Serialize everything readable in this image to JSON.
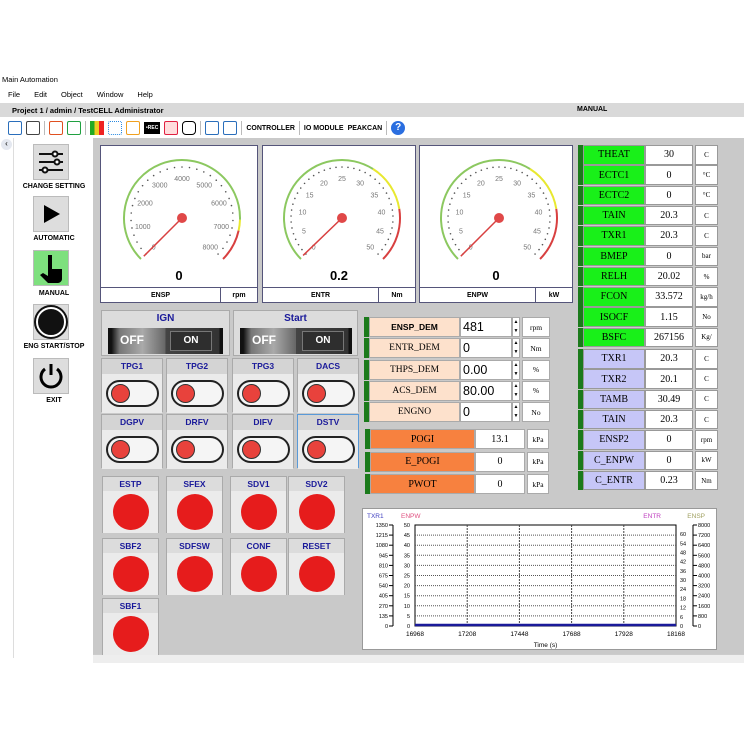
{
  "window": {
    "title": "Main Automation",
    "menu": [
      "File",
      "Edit",
      "Object",
      "Window",
      "Help"
    ],
    "project": "Project 1 / admin / TestCELL Administrator",
    "mode": "MANUAL"
  },
  "toolbar": {
    "controller": "CONTROLLER",
    "io_module": "IO MODULE",
    "peakcan": "PEAKCAN",
    "rec": "•REC",
    "help": "?"
  },
  "sidebar": {
    "collapse": "‹",
    "items": [
      {
        "label": "CHANGE SETTING",
        "icon": "sliders-icon"
      },
      {
        "label": "AUTOMATIC",
        "icon": "play-icon"
      },
      {
        "label": "MANUAL",
        "icon": "hand-pointer-icon",
        "active": true
      },
      {
        "label": "ENG START/STOP",
        "icon": "engine-start-stop-icon",
        "badge": "ENGINE START STOP"
      },
      {
        "label": "EXIT",
        "icon": "power-icon"
      }
    ]
  },
  "gauges": [
    {
      "name": "ENSP",
      "unit": "rpm",
      "value": "0",
      "min": 0,
      "max": 8000,
      "ticks": [
        "0",
        "1000",
        "2000",
        "3000",
        "4000",
        "5000",
        "6000",
        "7000",
        "8000"
      ],
      "needle": 0
    },
    {
      "name": "ENTR",
      "unit": "Nm",
      "value": "0.2",
      "min": 0,
      "max": 50,
      "ticks": [
        "0",
        "5",
        "10",
        "15",
        "20",
        "25",
        "30",
        "35",
        "40",
        "45",
        "50"
      ],
      "needle": 0.2
    },
    {
      "name": "ENPW",
      "unit": "kW",
      "value": "0",
      "min": 0,
      "max": 50,
      "ticks": [
        "0",
        "5",
        "10",
        "15",
        "20",
        "25",
        "30",
        "35",
        "40",
        "45",
        "50"
      ],
      "needle": 0
    }
  ],
  "rockers": [
    {
      "label": "IGN",
      "off": "OFF",
      "on": "ON"
    },
    {
      "label": "Start",
      "off": "OFF",
      "on": "ON"
    }
  ],
  "toggles": [
    "TPG1",
    "TPG2",
    "TPG3",
    "DACS",
    "DGPV",
    "DRFV",
    "DIFV",
    "DSTV"
  ],
  "buttons": [
    "ESTP",
    "SFEX",
    "SDV1",
    "SDV2",
    "SBF2",
    "SDFSW",
    "CONF",
    "RESET",
    "SBF1"
  ],
  "demands": [
    {
      "label": "ENSP_DEM",
      "value": "481",
      "unit": "rpm"
    },
    {
      "label": "ENTR_DEM",
      "value": "0",
      "unit": "Nm"
    },
    {
      "label": "THPS_DEM",
      "value": "0.00",
      "unit": "%"
    },
    {
      "label": "ACS_DEM",
      "value": "80.00",
      "unit": "%"
    },
    {
      "label": "ENGNO",
      "value": "0",
      "unit": "No"
    }
  ],
  "pressures": [
    {
      "label": "POGI",
      "value": "13.1",
      "unit": "kPa"
    },
    {
      "label": "E_POGI",
      "value": "0",
      "unit": "kPa"
    },
    {
      "label": "PWOT",
      "value": "0",
      "unit": "kPa"
    }
  ],
  "readings": [
    {
      "label": "THEAT",
      "value": "30",
      "unit": "C",
      "group": "green"
    },
    {
      "label": "ECTC1",
      "value": "0",
      "unit": "°C",
      "group": "green"
    },
    {
      "label": "ECTC2",
      "value": "0",
      "unit": "°C",
      "group": "green"
    },
    {
      "label": "TAIN",
      "value": "20.3",
      "unit": "C",
      "group": "green"
    },
    {
      "label": "TXR1",
      "value": "20.3",
      "unit": "C",
      "group": "green"
    },
    {
      "label": "BMEP",
      "value": "0",
      "unit": "bar",
      "group": "green"
    },
    {
      "label": "RELH",
      "value": "20.02",
      "unit": "%",
      "group": "green"
    },
    {
      "label": "FCON",
      "value": "33.572",
      "unit": "kg/h",
      "group": "green"
    },
    {
      "label": "ISOCF",
      "value": "1.15",
      "unit": "No",
      "group": "green"
    },
    {
      "label": "BSFC",
      "value": "267156",
      "unit": "Kg/",
      "group": "green"
    },
    {
      "label": "TXR1",
      "value": "20.3",
      "unit": "C",
      "group": "blue"
    },
    {
      "label": "TXR2",
      "value": "20.1",
      "unit": "C",
      "group": "blue"
    },
    {
      "label": "TAMB",
      "value": "30.49",
      "unit": "C",
      "group": "blue"
    },
    {
      "label": "TAIN",
      "value": "20.3",
      "unit": "C",
      "group": "blue"
    },
    {
      "label": "ENSP2",
      "value": "0",
      "unit": "rpm",
      "group": "blue"
    },
    {
      "label": "C_ENPW",
      "value": "0",
      "unit": "kW",
      "group": "blue"
    },
    {
      "label": "C_ENTR",
      "value": "0.23",
      "unit": "Nm",
      "group": "blue"
    }
  ],
  "colors": {
    "green": "#19f019",
    "blue": "#c6c6f7",
    "orange": "#f7813f",
    "peach": "#fde1cc"
  },
  "chart_data": {
    "type": "line",
    "xlabel": "Time (s)",
    "xlim": [
      16968,
      18168
    ],
    "xticks": [
      "16968",
      "17208",
      "17448",
      "17688",
      "17928",
      "18168"
    ],
    "grid": true,
    "axes": [
      {
        "name": "TXR1",
        "color": "#4040c0",
        "ticks": [
          "0",
          "135",
          "270",
          "405",
          "540",
          "675",
          "810",
          "945",
          "1080",
          "1215",
          "1350"
        ]
      },
      {
        "name": "ENPW",
        "color": "#e05080",
        "ticks": [
          "0",
          "5",
          "10",
          "15",
          "20",
          "25",
          "30",
          "35",
          "40",
          "45",
          "50"
        ]
      },
      {
        "name": "ENTR",
        "color": "#c040c0",
        "ticks": [
          "0",
          "6",
          "12",
          "18",
          "24",
          "30",
          "36",
          "42",
          "48",
          "54",
          "60"
        ]
      },
      {
        "name": "ENSP",
        "color": "#a0a060",
        "ticks": [
          "0",
          "800",
          "1600",
          "2400",
          "3200",
          "4000",
          "4800",
          "5600",
          "6400",
          "7200",
          "8000"
        ]
      }
    ],
    "series": [
      {
        "name": "TXR1",
        "values": [
          [
            16968,
            0
          ],
          [
            18168,
            0
          ]
        ]
      }
    ]
  }
}
